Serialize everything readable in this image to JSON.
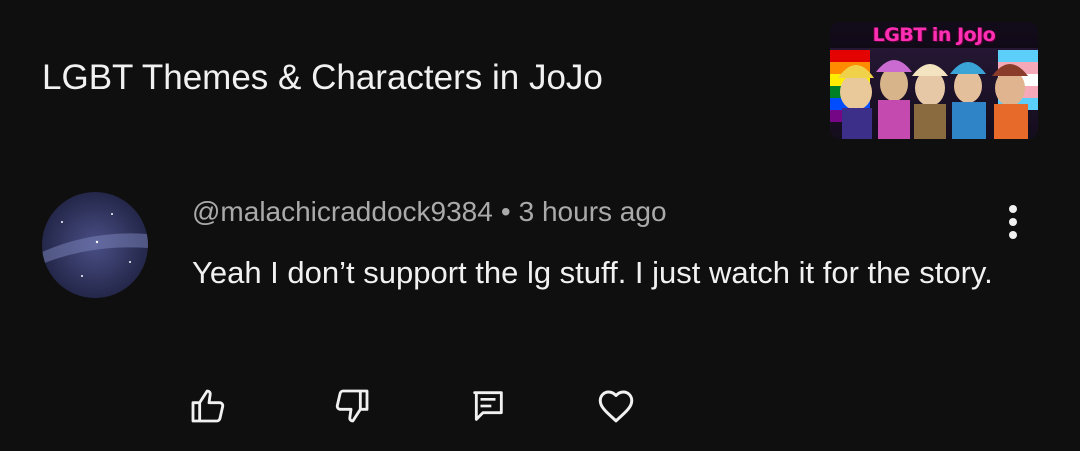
{
  "video": {
    "title": "LGBT Themes & Characters in JoJo",
    "thumbnail_caption": "LGBT in JoJo"
  },
  "comment": {
    "author": "@malachicraddock9384",
    "separator": "•",
    "time": "3 hours ago",
    "text": "Yeah I don’t support the lg stuff. I just watch it for the story."
  },
  "actions": {
    "like_icon": "thumbs-up-icon",
    "dislike_icon": "thumbs-down-icon",
    "reply_icon": "reply-comment-icon",
    "heart_icon": "heart-icon",
    "more_icon": "more-vertical-icon"
  },
  "colors": {
    "background": "#0f0f0f",
    "primary_text": "#f1f1f1",
    "secondary_text": "#aaaaaa",
    "caption_pink": "#ff2fb4"
  }
}
